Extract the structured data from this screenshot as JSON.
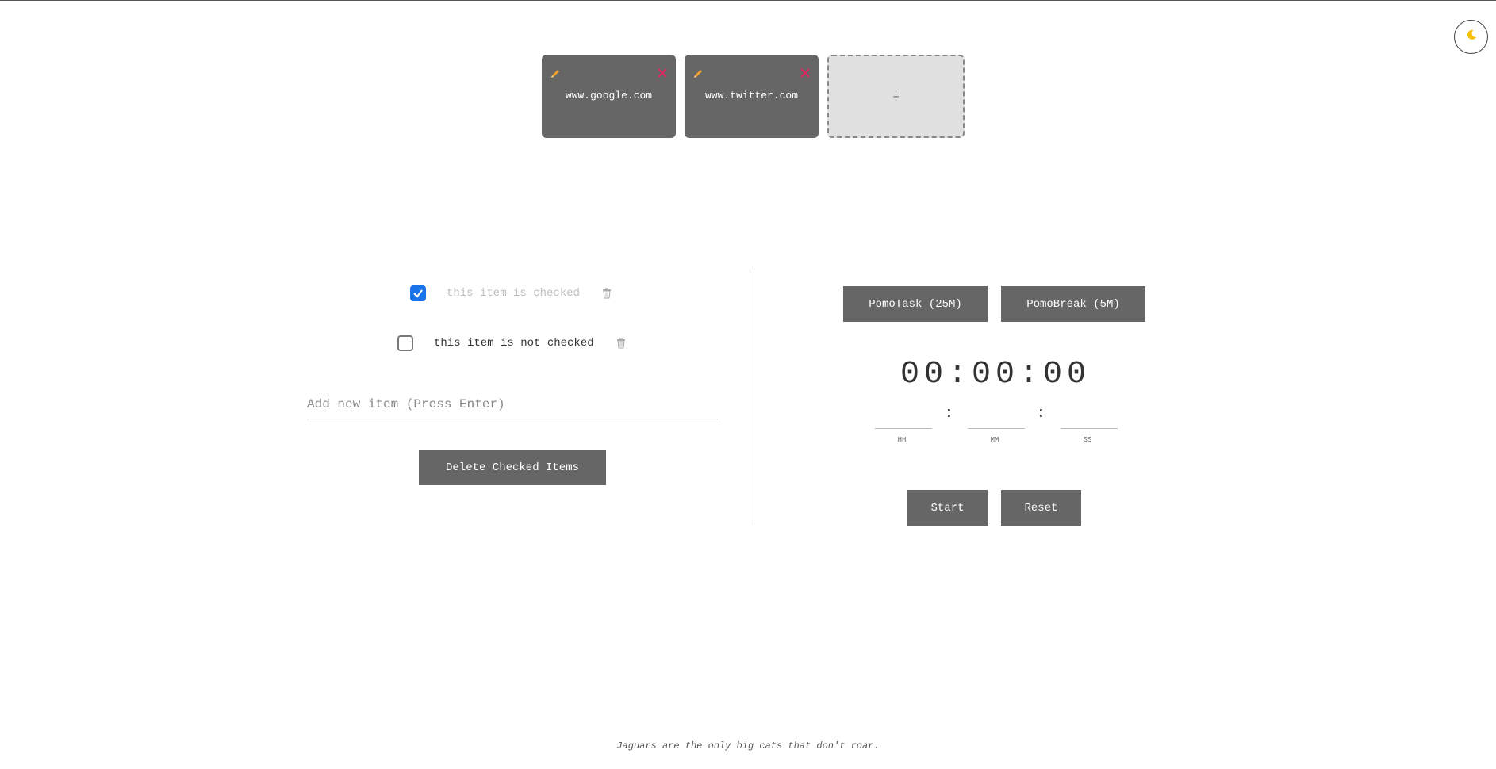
{
  "theme_toggle": {
    "icon": "moon-icon",
    "color": "#f5c000"
  },
  "shortcuts": [
    {
      "url": "www.google.com"
    },
    {
      "url": "www.twitter.com"
    }
  ],
  "add_shortcut": {
    "label": "+"
  },
  "todo": {
    "items": [
      {
        "text": "this item is checked",
        "checked": true
      },
      {
        "text": "this item is not checked",
        "checked": false
      }
    ],
    "new_item_placeholder": "Add new item (Press Enter)",
    "delete_checked_label": "Delete Checked Items"
  },
  "pomodoro": {
    "task_label": "PomoTask (25M)",
    "break_label": "PomoBreak (5M)",
    "display": "00:00:00",
    "hh_label": "HH",
    "mm_label": "MM",
    "ss_label": "SS",
    "colon": ":",
    "start_label": "Start",
    "reset_label": "Reset"
  },
  "footer": {
    "fact": "Jaguars are the only big cats that don't roar."
  },
  "colors": {
    "card_bg": "#666666",
    "edit_icon": "#f0a030",
    "close_icon": "#e0245e",
    "checkbox": "#1a73e8"
  }
}
